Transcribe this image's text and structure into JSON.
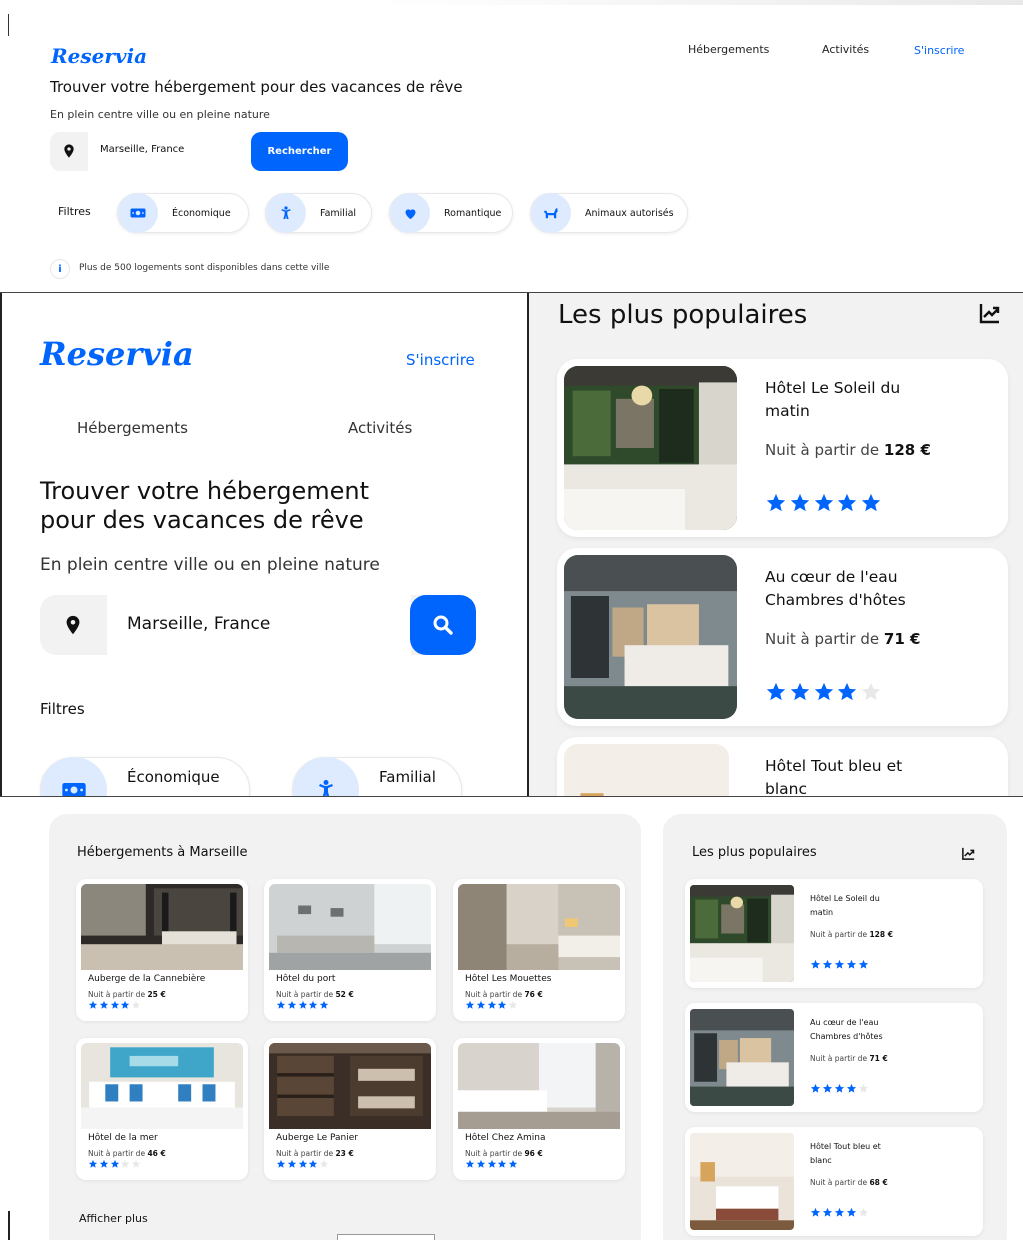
{
  "brand": "Reservia",
  "nav": {
    "hebergements": "Hébergements",
    "activites": "Activités",
    "signup": "S'inscrire"
  },
  "hero": {
    "title": "Trouver votre hébergement pour des vacances de rêve",
    "title_line1": "Trouver votre hébergement",
    "title_line2": "pour des vacances de rêve",
    "subtitle": "En plein centre ville ou en pleine nature"
  },
  "search": {
    "value": "Marseille, France",
    "button_label": "Rechercher"
  },
  "filters": {
    "label": "Filtres",
    "items": [
      "Économique",
      "Familial",
      "Romantique",
      "Animaux autorisés"
    ]
  },
  "info": {
    "icon_text": "i",
    "text": "Plus de 500 logements sont disponibles dans cette ville"
  },
  "popular": {
    "title": "Les plus populaires",
    "price_prefix": "Nuit à partir de",
    "items": [
      {
        "name_line1": "Hôtel Le Soleil du",
        "name_line2": "matin",
        "price": "128 €",
        "rating": 5
      },
      {
        "name_line1": "Au cœur de l'eau",
        "name_line2": "Chambres d'hôtes",
        "price": "71 €",
        "rating": 4
      },
      {
        "name_line1": "Hôtel Tout bleu et",
        "name_line2": "blanc",
        "price": "68 €",
        "rating": 4
      }
    ]
  },
  "accommodations": {
    "title": "Hébergements à Marseille",
    "price_prefix": "Nuit à partir de",
    "items": [
      {
        "name": "Auberge de la Cannebière",
        "price": "25 €",
        "rating": 4
      },
      {
        "name": "Hôtel du port",
        "price": "52 €",
        "rating": 5
      },
      {
        "name": "Hôtel Les Mouettes",
        "price": "76 €",
        "rating": 4
      },
      {
        "name": "Hôtel de la mer",
        "price": "46 €",
        "rating": 3
      },
      {
        "name": "Auberge Le Panier",
        "price": "23 €",
        "rating": 4
      },
      {
        "name": "Hôtel Chez Amina",
        "price": "96 €",
        "rating": 5
      }
    ],
    "show_more": "Afficher plus"
  },
  "colors": {
    "primary": "#0065fc",
    "primary_light": "#deebff",
    "panel_bg": "#f2f2f2"
  },
  "icons": {
    "location": "location-pin-icon",
    "search": "magnifier-icon",
    "trend": "trending-up-icon",
    "economique": "money-icon",
    "familial": "child-icon",
    "romantique": "heart-icon",
    "animaux": "dog-icon",
    "info": "info-icon",
    "star": "star-icon"
  }
}
